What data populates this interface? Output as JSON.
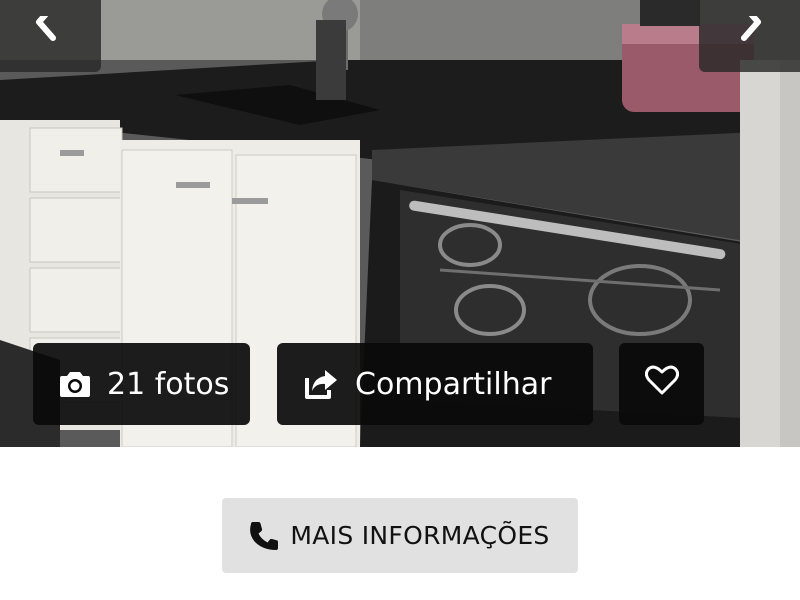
{
  "gallery": {
    "image_alt": "kitchen-photo",
    "prev_icon": "chevron-left-icon",
    "next_icon": "chevron-right-icon"
  },
  "actions": {
    "photos": {
      "icon": "camera-icon",
      "label": "21 fotos"
    },
    "share": {
      "icon": "share-icon",
      "label": "Compartilhar"
    },
    "favorite": {
      "icon": "heart-icon"
    }
  },
  "contact": {
    "icon": "phone-icon",
    "label": "MAIS INFORMAÇÕES"
  },
  "colors": {
    "overlay_button": "#0a0a0a",
    "info_button": "#e1e1e1",
    "text_light": "#ffffff",
    "text_dark": "#111111"
  }
}
